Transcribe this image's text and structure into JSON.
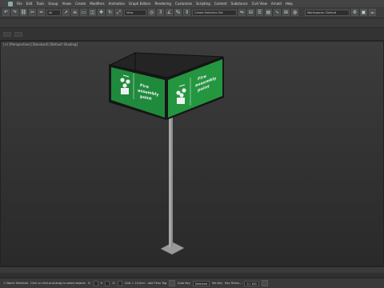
{
  "menu": {
    "items": [
      "File",
      "Edit",
      "Tools",
      "Group",
      "Views",
      "Create",
      "Modifiers",
      "Animation",
      "Graph Editors",
      "Rendering",
      "Customize",
      "Scripting",
      "Content",
      "Substance",
      "Civil View",
      "Arnold",
      "Help"
    ]
  },
  "toolbar": {
    "filter_value": "All",
    "reference_value": "View",
    "selection_set_placeholder": "Create Selection Set",
    "workspace_value": "Workspaces: Default"
  },
  "viewport": {
    "label": "[+] [Perspective] [Standard] [Default Shading]"
  },
  "sign": {
    "left_panel_text": [
      "Fire",
      "assembly",
      "point"
    ],
    "right_panel_text": [
      "Fire",
      "assembly",
      "point"
    ],
    "panel_color": "#1f8a3b",
    "frame_color": "#1a1a1a",
    "pole_color": "#a8a8a8"
  },
  "status": {
    "selected_text": "1 Object Selected",
    "prompt_text": "Click or click-and-drag to select objects",
    "x_label": "X:",
    "y_label": "Y:",
    "z_label": "Z:",
    "grid_text": "Grid = 10,0cm",
    "addtime_text": "Add Time Tag",
    "autokey_label": "Auto Key",
    "selected_dropdown": "Selected",
    "setkey_label": "Set Key",
    "keyfilters_label": "Key Filters..."
  },
  "timeline": {
    "frame_counter": "0 / 100"
  }
}
